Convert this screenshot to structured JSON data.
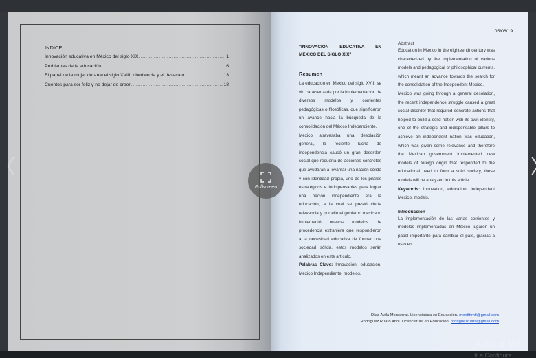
{
  "left_page": {
    "index_title": "INDICE",
    "entries": [
      {
        "title": "Innovación educativa en México del siglo XIX",
        "page": "1"
      },
      {
        "title": "Problemas de la educación",
        "page": "6"
      },
      {
        "title": "El papel de la mujer durante el siglo XVIII: obediencia y el desacato",
        "page": "13"
      },
      {
        "title": "Cuentos para ser feliz y no dejar de creer",
        "page": "18"
      }
    ]
  },
  "right_page": {
    "date": "05/06/19.",
    "title_line1": "\"INNOVACIÓN EDUCATIVA EN",
    "title_line2": "MÉXICO DEL SIGLO XIX\"",
    "resumen_heading": "Resumen",
    "resumen_p1": "La educacion en Mexico del siglo XVIII se vio caracterizada por la implementación de diversos modelos y corrientes pedagógicas o filosóficas, que significaron un avance hacia la búsqueda de la consolidación del México Independiente.",
    "resumen_p2": "México atravesaba una desolación general, la reciente lucha de independencia causó un gran desorden social que requería de acciones concretas que ayudaran a levantar una nación sólida y con identidad propia, uno de los pilares estratégicos e indispensables para lograr una nación independiente era la educación, a la cual se prestó cierta relevancia y por ello el gobierno mexicano implementó nuevos modelos de procedencia extranjera que respondieron a la necesidad educativa de formar una sociedad sólida, estos modelos serán analizados en este artículo.",
    "palabras_label": "Palabras Clave:",
    "palabras_value": "Innovación, educación, México Independiente, modelos.",
    "abstract_label": "Abstract",
    "abstract_p1": "Education in Mexico in the eighteenth century was characterized by the implementation of various models and pedagogical or philosophical currents, which meant an advance towards the search for the consolidation of the Independent Mexico.",
    "abstract_p2": "Mexico was going through a general desolation, the recent independence struggle caused a great social disorder that required concrete actions that helped to build a solid nation with its own identity, one of the strategic and indispensable pillars to achieve an independent nation was education, which was given some relevance and therefore the Mexican government implemented new models of foreign origin that responded to the educational need to form a solid society, these models will be analyzed in this article.",
    "keywords_label": "Keywords:",
    "keywords_value": "Innovation, education, Independent Mexico, models.",
    "intro_heading": "Introducción",
    "intro_p1": "La implementación de las varias corrientes y modelos implementadas en México jugaron un papel importante para cambiar el país, gracias a esto en",
    "author1_text": "Díaz Ávila Monserrat. Licenciatura en Educación.",
    "author1_email": "monttttmtl@gmail.com",
    "author2_text": "Rodríguez Ruaro Abril. Licenciatura en Educación.",
    "author2_email": "rodriguezruaro@gmail.com"
  },
  "viewer": {
    "fullscreen_label": "Fullscreen",
    "prev_arrow": "〈",
    "next_arrow": "〉",
    "watermark_title": "Activar Wi",
    "watermark_sub": "Ir a Configura"
  }
}
